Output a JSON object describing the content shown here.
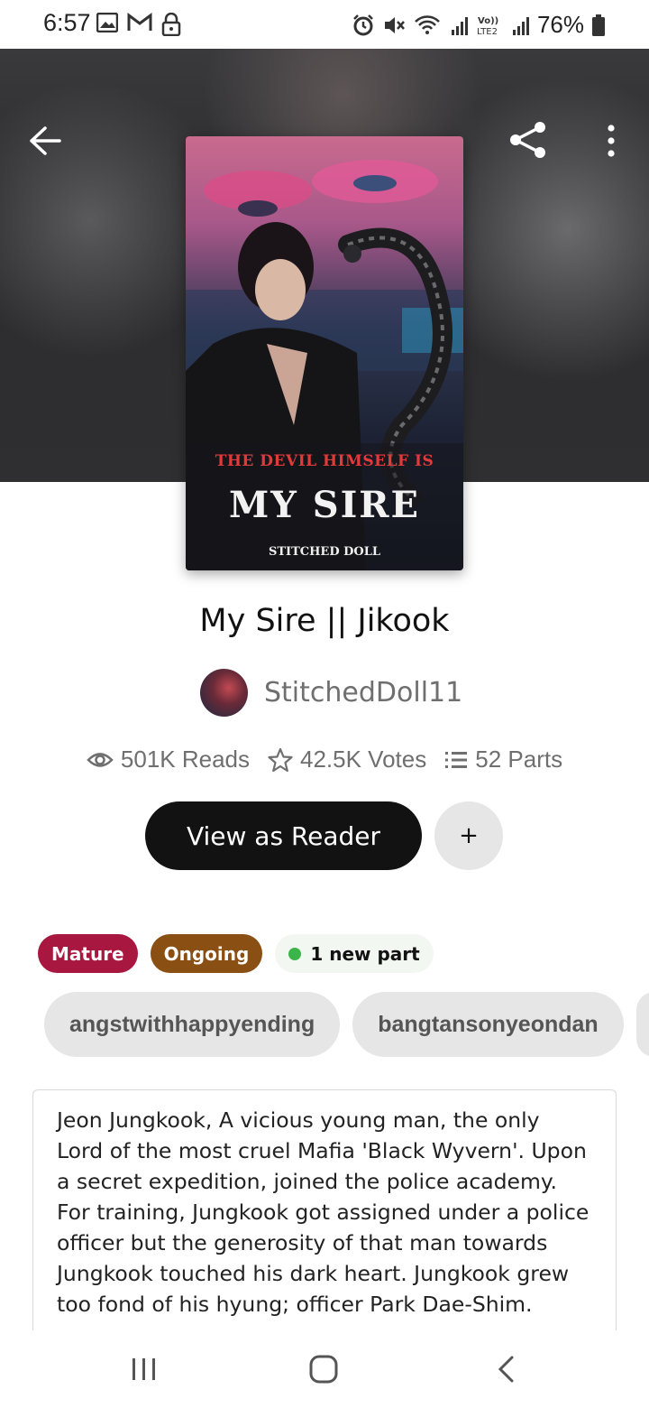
{
  "status_bar": {
    "time": "6:57",
    "battery_percent": "76%",
    "left_icons": [
      "gallery-icon",
      "gmail-icon",
      "lock-icon"
    ],
    "right_icons": [
      "alarm-icon",
      "mute-icon",
      "wifi-icon",
      "signal-icon",
      "volte-icon",
      "battery-icon"
    ]
  },
  "header": {
    "back_icon": "arrow-left-icon",
    "share_icon": "share-icon",
    "more_icon": "more-vertical-icon"
  },
  "cover": {
    "top_text": "THE DEVIL HIMSELF IS",
    "title_text": "MY SIRE",
    "author_text": "STITCHED DOLL"
  },
  "story": {
    "title": "My Sire || Jikook",
    "author": "StitchedDoll11",
    "stats": {
      "reads": "501K Reads",
      "votes": "42.5K Votes",
      "parts": "52 Parts"
    },
    "view_button_label": "View as Reader",
    "add_button_label": "+",
    "badges": {
      "mature": "Mature",
      "ongoing": "Ongoing",
      "new_part": "1 new part"
    },
    "tags": [
      "angstwithhappyending",
      "bangtansonyeondan"
    ],
    "description": "Jeon Jungkook, A vicious young man, the only Lord of the most cruel Mafia 'Black Wyvern'. Upon a secret expedition, joined the police academy. For training, Jungkook got assigned under a police officer but the generosity of that man towards Jungkook touched his dark heart. Jungkook grew too fond of his hyung; officer Park Dae-Shim."
  },
  "colors": {
    "mature": "#a8173f",
    "ongoing": "#8a4f12",
    "new_dot": "#3bb54a",
    "primary_button": "#121212"
  }
}
